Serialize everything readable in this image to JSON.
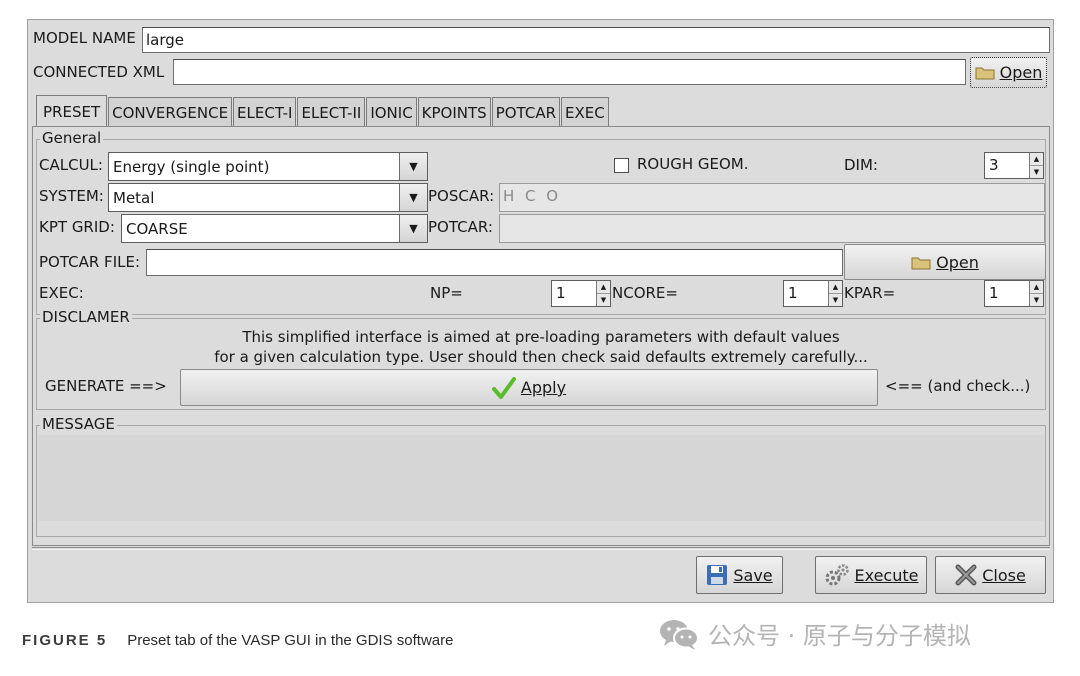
{
  "top": {
    "model_name_label": "MODEL NAME",
    "model_name_value": "large",
    "connected_xml_label": "CONNECTED XML",
    "connected_xml_value": "",
    "open_label": "Open"
  },
  "tabs": [
    {
      "label": "PRESET",
      "active": true
    },
    {
      "label": "CONVERGENCE",
      "active": false
    },
    {
      "label": "ELECT-I",
      "active": false
    },
    {
      "label": "ELECT-II",
      "active": false
    },
    {
      "label": "IONIC",
      "active": false
    },
    {
      "label": "KPOINTS",
      "active": false
    },
    {
      "label": "POTCAR",
      "active": false
    },
    {
      "label": "EXEC",
      "active": false
    }
  ],
  "general": {
    "title": "General",
    "calcul_label": "CALCUL:",
    "calcul_value": "Energy (single point)",
    "system_label": "SYSTEM:",
    "system_value": "Metal",
    "kpt_label": "KPT GRID:",
    "kpt_value": "COARSE",
    "rough_label": "ROUGH GEOM.",
    "rough_checked": false,
    "dim_label": "DIM:",
    "dim_value": "3",
    "poscar_label": "POSCAR:",
    "poscar_value": "H C O",
    "potcar_label": "POTCAR:",
    "potcar_value": "",
    "potcar_file_label": "POTCAR FILE:",
    "potcar_file_value": "",
    "open_label": "Open",
    "exec_label": "EXEC:",
    "np_label": "NP=",
    "np_value": "1",
    "ncore_label": "NCORE=",
    "ncore_value": "1",
    "kpar_label": "KPAR=",
    "kpar_value": "1"
  },
  "disclaimer": {
    "title": "DISCLAMER",
    "line1": "This simplified interface is aimed at pre-loading parameters with default values",
    "line2": "for a given calculation type. User should then check said defaults extremely carefully...",
    "generate_label": "GENERATE ==>",
    "apply_label": "Apply",
    "check_label": "<== (and check...)"
  },
  "message": {
    "title": "MESSAGE",
    "text": ""
  },
  "footer": {
    "save_label": "Save",
    "execute_label": "Execute",
    "close_label": "Close"
  },
  "caption": {
    "label": "FIGURE 5",
    "text": "Preset tab of the VASP GUI in the GDIS software"
  },
  "watermark": {
    "text": "公众号 · 原子与分子模拟"
  },
  "icons": {
    "folder": "folder-icon",
    "check": "checkmark-icon",
    "save": "floppy-disk-icon",
    "execute": "gears-icon",
    "close": "x-icon",
    "wechat": "wechat-icon"
  },
  "colors": {
    "window_bg": "#dcdcdc",
    "folder": "#d9c27a",
    "check": "#5bbd2a",
    "save": "#3a6fb5",
    "close": "#555555",
    "watermark": "#b4b4b4"
  }
}
